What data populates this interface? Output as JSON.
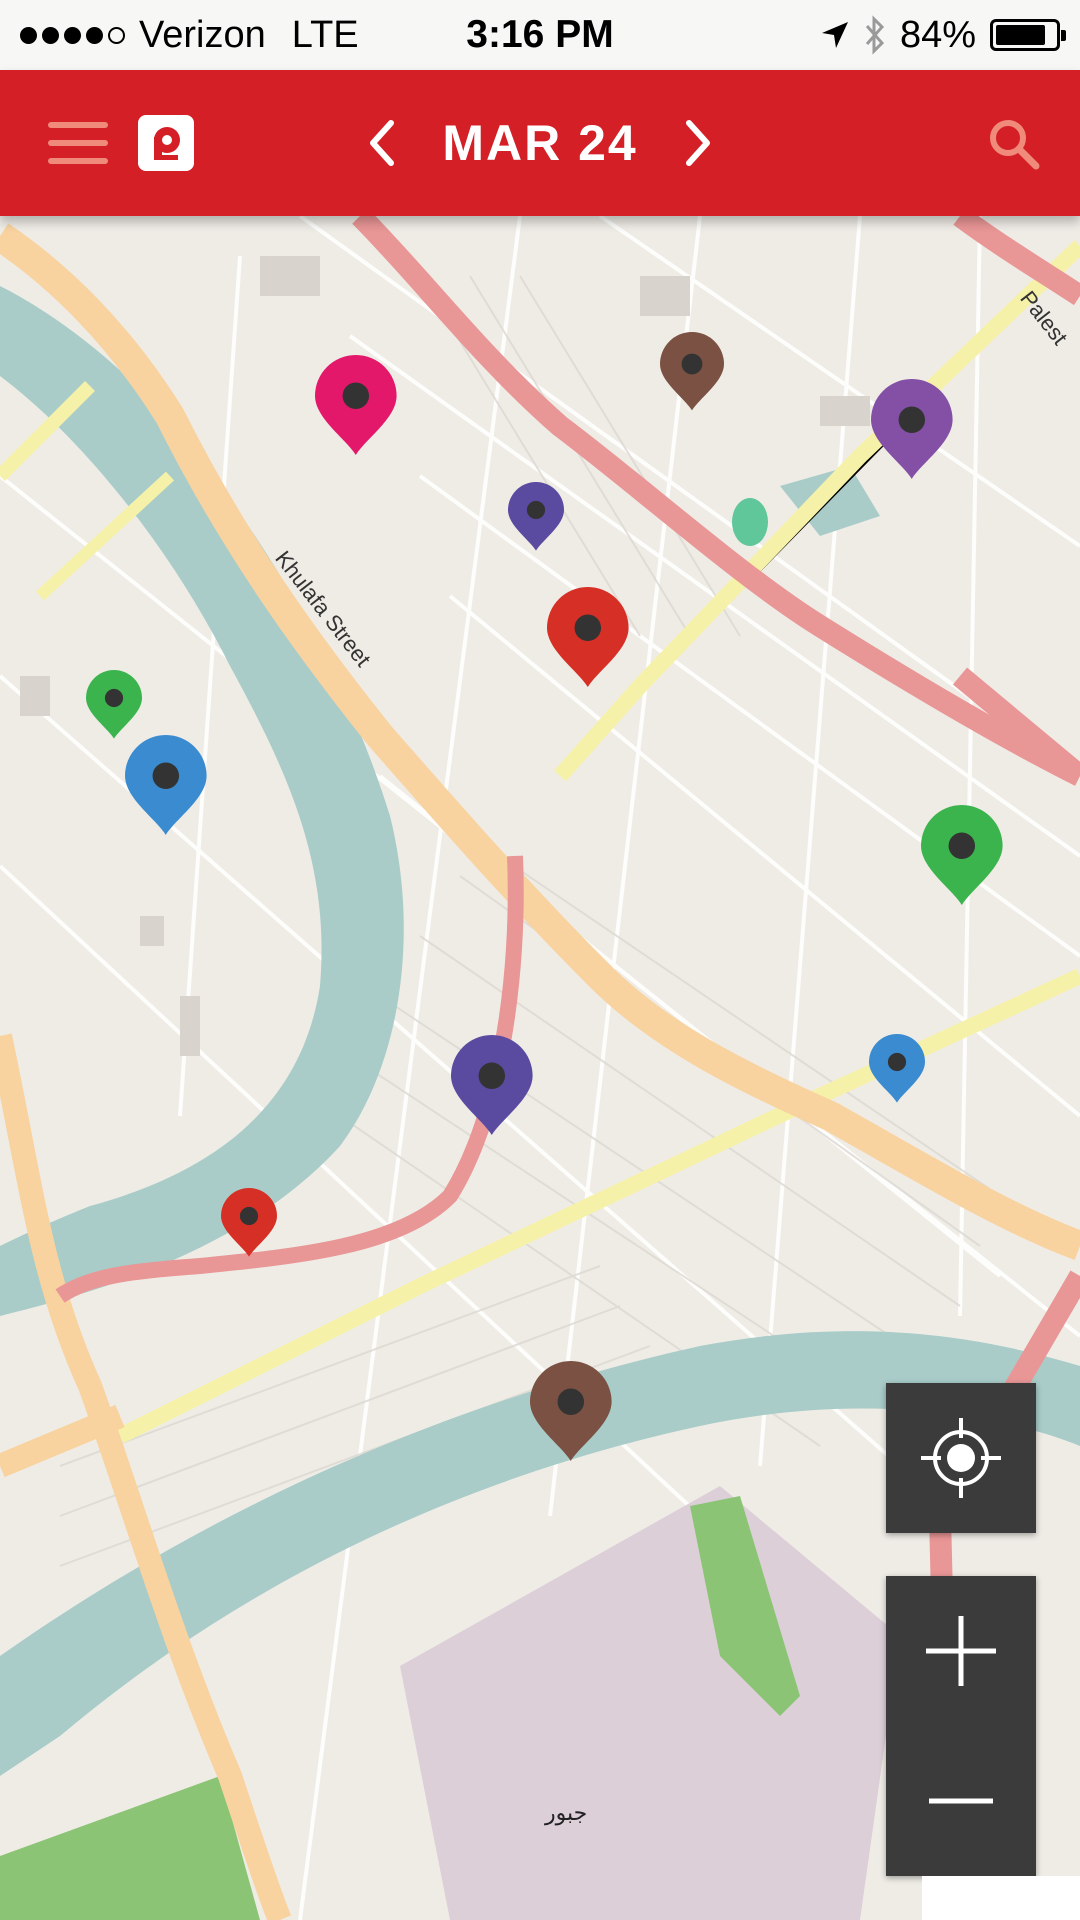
{
  "status_bar": {
    "carrier": "Verizon",
    "network": "LTE",
    "time": "3:16 PM",
    "battery": "84%",
    "battery_level": 0.84,
    "icons": [
      "signal-icon",
      "location-arrow-icon",
      "bluetooth-icon",
      "battery-icon"
    ]
  },
  "header": {
    "date": "MAR 24",
    "colors": {
      "bar": "#d41f26",
      "icons": "#f08a7a",
      "text": "#ffffff"
    },
    "icons": [
      "hamburger-menu-icon",
      "app-logo-icon",
      "chevron-left-icon",
      "chevron-right-icon",
      "search-icon"
    ]
  },
  "map": {
    "labels": {
      "street": "Khulafa Street",
      "street2": "Palest",
      "place": "جبور"
    },
    "pins": [
      {
        "id": "pin-pink",
        "color": "#e4186a",
        "size": "large"
      },
      {
        "id": "pin-brown-top",
        "color": "#7a5143",
        "size": "medium"
      },
      {
        "id": "pin-purple-top",
        "color": "#8350a6",
        "size": "large"
      },
      {
        "id": "pin-indigo-small",
        "color": "#5a4aa0",
        "size": "small"
      },
      {
        "id": "pin-red-center",
        "color": "#d62f26",
        "size": "large"
      },
      {
        "id": "pin-green-small",
        "color": "#3cb44e",
        "size": "small"
      },
      {
        "id": "pin-blue-left",
        "color": "#3a8bd0",
        "size": "large"
      },
      {
        "id": "pin-green-right",
        "color": "#3cb44e",
        "size": "large"
      },
      {
        "id": "pin-indigo-bottom",
        "color": "#5a4aa0",
        "size": "large"
      },
      {
        "id": "pin-blue-small",
        "color": "#3a8bd0",
        "size": "small"
      },
      {
        "id": "pin-red-small",
        "color": "#d62f26",
        "size": "small"
      },
      {
        "id": "pin-brown-bottom",
        "color": "#7a5143",
        "size": "large"
      }
    ]
  },
  "controls": {
    "icons": [
      "locate-me-icon",
      "zoom-in-icon",
      "zoom-out-icon"
    ],
    "background": "#3b3b3b"
  }
}
